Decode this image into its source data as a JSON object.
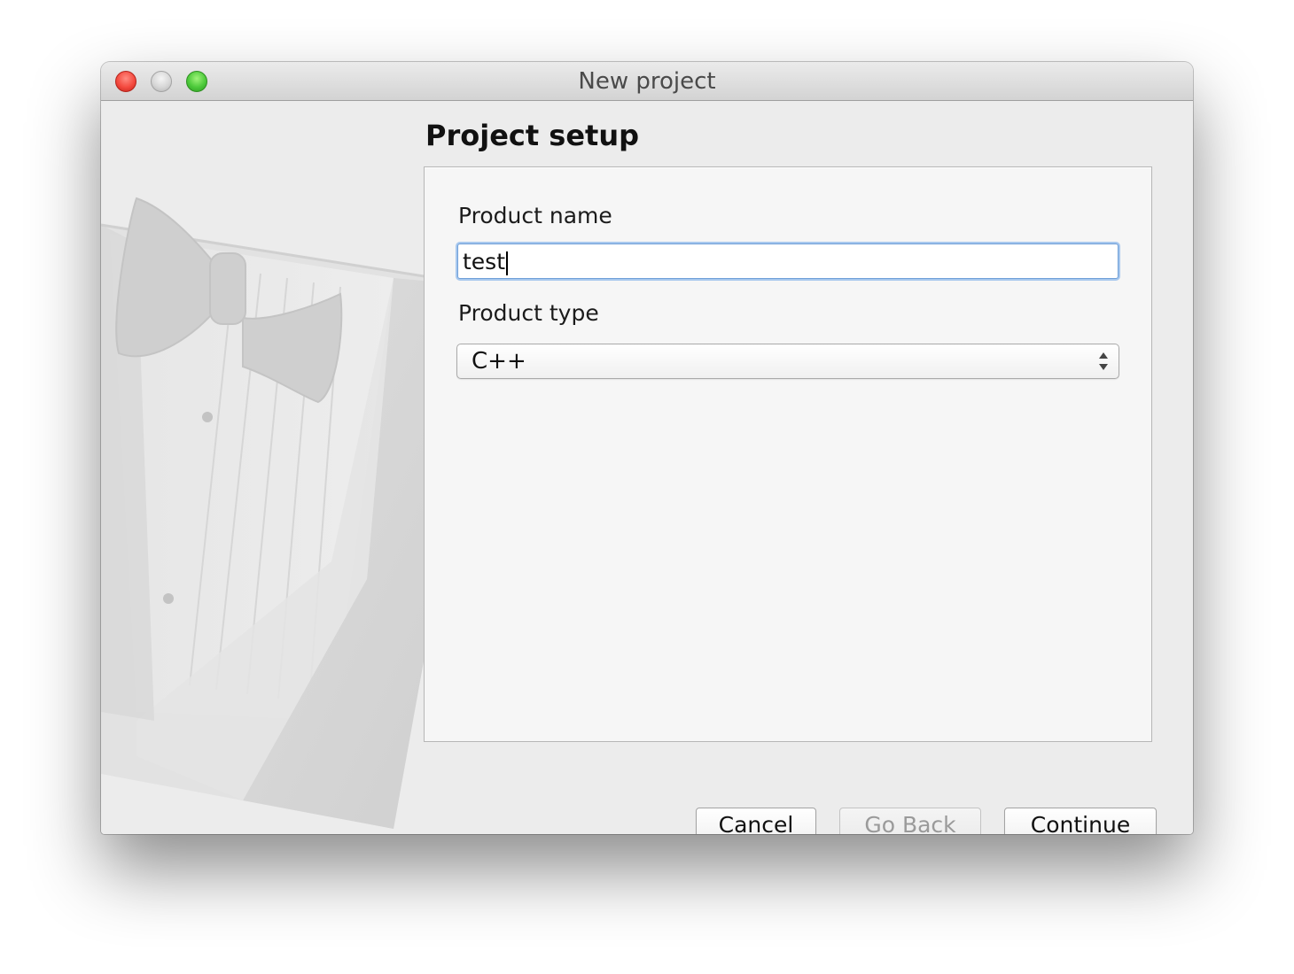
{
  "window": {
    "title": "New project"
  },
  "page": {
    "heading": "Project setup"
  },
  "form": {
    "product_name_label": "Product name",
    "product_name_value": "test",
    "product_type_label": "Product type",
    "product_type_value": "C++"
  },
  "buttons": {
    "cancel": "Cancel",
    "go_back": "Go Back",
    "continue": "Continue"
  },
  "icons": {
    "close": "close-icon",
    "minimize": "minimize-icon",
    "zoom": "zoom-icon",
    "select_arrows": "up-down-arrows-icon",
    "artwork": "tuxedo-bowtie-illustration"
  },
  "colors": {
    "close": "#f44a3f",
    "minimize": "#d7d7d7",
    "zoom": "#4cc93a",
    "focus_ring": "#a8c8ee",
    "disabled_text": "#9a9a9a"
  }
}
